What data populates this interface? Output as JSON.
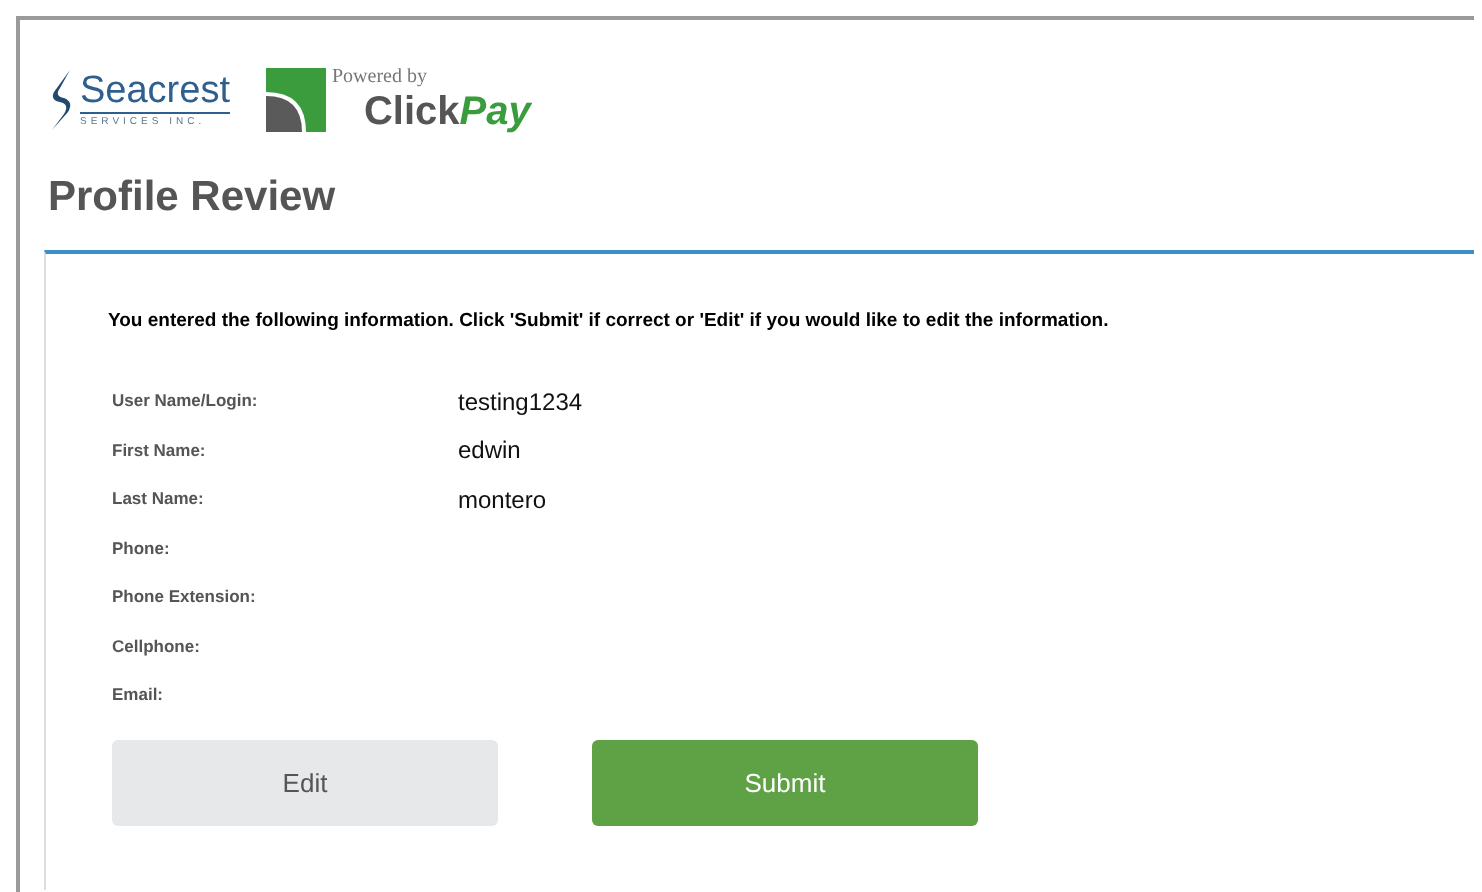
{
  "header": {
    "seacrest_logo": {
      "name": "Seacrest",
      "tagline": "SERVICES INC."
    },
    "clickpay_logo": {
      "powered_by": "Powered by",
      "click": "Click",
      "pay": "Pay"
    }
  },
  "title": "Profile Review",
  "instructions": "You entered the following information. Click 'Submit' if correct or 'Edit' if you would like to edit the information.",
  "fields": [
    {
      "label": "User Name/Login:",
      "value": "testing1234"
    },
    {
      "label": "First Name:",
      "value": "edwin"
    },
    {
      "label": "Last Name:",
      "value": "montero"
    },
    {
      "label": "Phone:"
    },
    {
      "label": "Phone Extension:"
    },
    {
      "label": "Cellphone:"
    },
    {
      "label": "Email:"
    }
  ],
  "buttons": [
    {
      "label": "Edit",
      "kind": "secondary"
    },
    {
      "label": "Submit",
      "kind": "primary"
    }
  ]
}
